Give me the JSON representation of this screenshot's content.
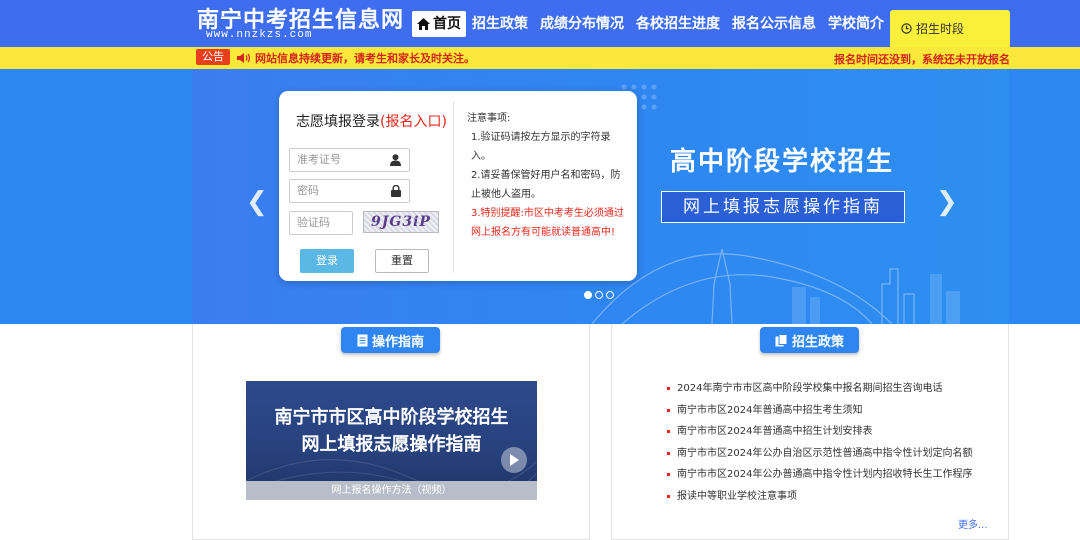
{
  "site": {
    "title": "南宁中考招生信息网",
    "url": "www.nnzkzs.com"
  },
  "nav": {
    "items": [
      "首页",
      "招生政策",
      "成绩分布情况",
      "各校招生进度",
      "报名公示信息",
      "学校简介"
    ],
    "active": 0
  },
  "schedule": {
    "label": "招生时段"
  },
  "notice": {
    "badge": "公告",
    "text": "网站信息持续更新，请考生和家长及时关注。",
    "right": "报名时间还没到，系统还未开放报名"
  },
  "banner": {
    "title": "高中阶段学校招生",
    "subtitle": "网上填报志愿操作指南",
    "slide_count": 3,
    "active_slide": 0
  },
  "login": {
    "title": "志愿填报登录",
    "title_highlight": "(报名入口)",
    "exam_id_placeholder": "准考证号",
    "password_placeholder": "密码",
    "captcha_placeholder": "验证码",
    "captcha_text": "9JG3iP",
    "login_button": "登录",
    "reset_button": "重置",
    "notes_title": "注意事项:",
    "notes": [
      "1.验证码请按左方显示的字符录入。",
      "2.请妥善保管好用户名和密码，防止被他人盗用。"
    ],
    "warning": "3.特别提醒:市区中考考生必须通过网上报名方有可能就读普通高中!"
  },
  "guide": {
    "heading": "操作指南",
    "video_title_line1": "南宁市市区高中阶段学校招生",
    "video_title_line2": "网上填报志愿操作指南",
    "video_caption": "网上报名操作方法（视频）"
  },
  "policy": {
    "heading": "招生政策",
    "items": [
      "2024年南宁市市区高中阶段学校集中报名期间招生咨询电话",
      "南宁市市区2024年普通高中招生考生须知",
      "南宁市市区2024年普通高中招生计划安排表",
      "南宁市市区2024年公办自治区示范性普通高中指令性计划定向名额",
      "南宁市市区2024年公办普通高中指令性计划内招收特长生工作程序",
      "报读中等职业学校注意事项"
    ],
    "more": "更多..."
  },
  "colors": {
    "primary": "#3f6df0",
    "banner": "#2f86f2",
    "notice_bg": "#fbe83a",
    "alert": "#e8251b"
  }
}
